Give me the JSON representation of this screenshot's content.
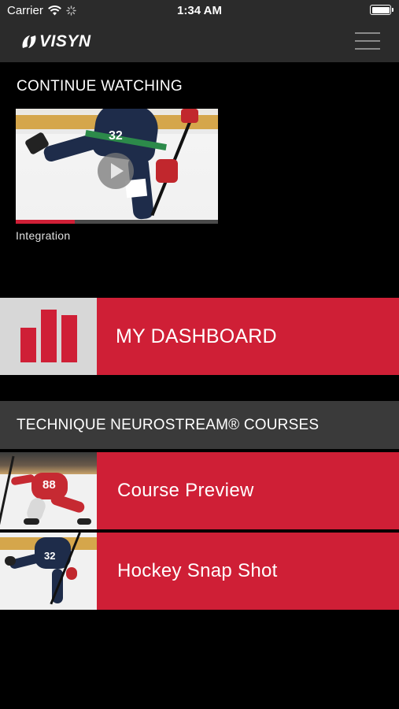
{
  "status_bar": {
    "carrier": "Carrier",
    "time": "1:34 AM"
  },
  "header": {
    "logo_text": "VISYN"
  },
  "continue_watching": {
    "title": "CONTINUE WATCHING",
    "video": {
      "label": "Integration",
      "thumbnail_number": "32",
      "progress": 0.29
    }
  },
  "dashboard": {
    "label": "MY DASHBOARD"
  },
  "courses": {
    "title": "TECHNIQUE NEUROSTREAM® COURSES",
    "items": [
      {
        "label": "Course Preview",
        "thumbnail_number": "88"
      },
      {
        "label": "Hockey Snap Shot",
        "thumbnail_number": "32"
      }
    ]
  },
  "colors": {
    "accent_red": "#cf1f36",
    "header_bg": "#2b2b2b",
    "section_bg": "#3a3a3a",
    "icon_box_bg": "#d7d7d7"
  }
}
